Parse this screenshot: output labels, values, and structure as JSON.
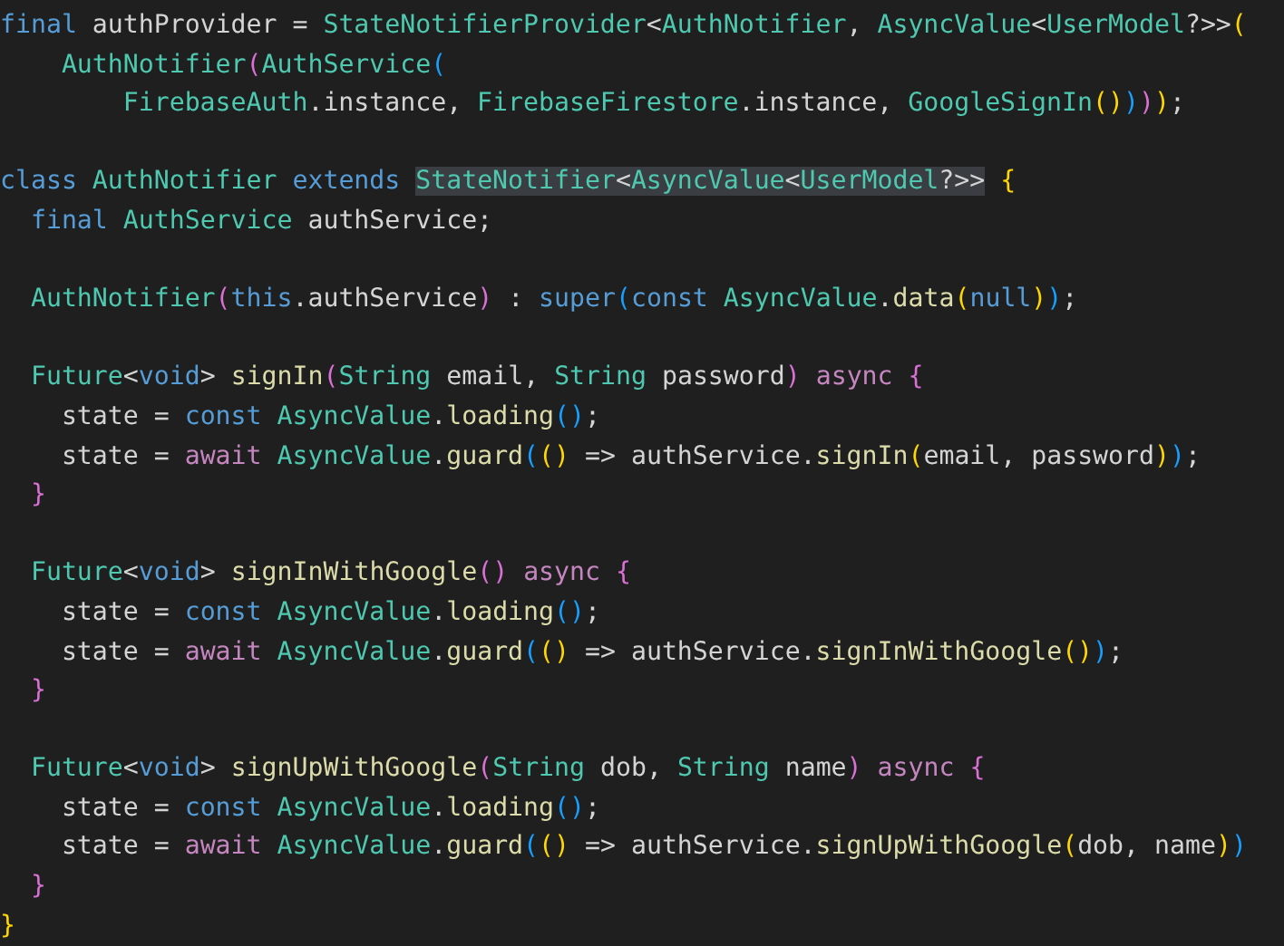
{
  "editor": {
    "lines": [
      {
        "kind": "code",
        "tokens": [
          {
            "t": "final",
            "kind": "keyword"
          },
          {
            "t": " authProvider = ",
            "kind": "plain"
          },
          {
            "t": "StateNotifierProvider",
            "kind": "type"
          },
          {
            "t": "<",
            "kind": "plain"
          },
          {
            "t": "AuthNotifier",
            "kind": "type"
          },
          {
            "t": ", ",
            "kind": "plain"
          },
          {
            "t": "AsyncValue",
            "kind": "type"
          },
          {
            "t": "<",
            "kind": "plain"
          },
          {
            "t": "UserModel",
            "kind": "type"
          },
          {
            "t": "?>>",
            "kind": "plain"
          },
          {
            "t": "(",
            "kind": "bracket1"
          }
        ]
      },
      {
        "kind": "code",
        "tokens": [
          {
            "t": "    AuthNotifier",
            "kind": "type"
          },
          {
            "t": "(",
            "kind": "bracket2"
          },
          {
            "t": "AuthService",
            "kind": "type"
          },
          {
            "t": "(",
            "kind": "bracket3"
          }
        ]
      },
      {
        "kind": "code",
        "tokens": [
          {
            "t": "        FirebaseAuth",
            "kind": "type"
          },
          {
            "t": ".instance, ",
            "kind": "plain"
          },
          {
            "t": "FirebaseFirestore",
            "kind": "type"
          },
          {
            "t": ".instance, ",
            "kind": "plain"
          },
          {
            "t": "GoogleSignIn",
            "kind": "type"
          },
          {
            "t": "()",
            "kind": "bracket1"
          },
          {
            "t": ")",
            "kind": "bracket3"
          },
          {
            "t": ")",
            "kind": "bracket2"
          },
          {
            "t": ")",
            "kind": "bracket1"
          },
          {
            "t": ";",
            "kind": "plain"
          }
        ]
      },
      {
        "kind": "blank"
      },
      {
        "kind": "code",
        "tokens": [
          {
            "t": "class",
            "kind": "keyword"
          },
          {
            "t": " AuthNotifier ",
            "kind": "type"
          },
          {
            "t": "extends ",
            "kind": "keyword"
          },
          {
            "t": "StateNotifier",
            "kind": "type",
            "highlighted": true
          },
          {
            "t": "<",
            "kind": "plain",
            "highlighted": true
          },
          {
            "t": "AsyncValue",
            "kind": "type",
            "highlighted": true
          },
          {
            "t": "<",
            "kind": "plain",
            "highlighted": true
          },
          {
            "t": "UserModel",
            "kind": "type",
            "highlighted": true
          },
          {
            "t": "?>>",
            "kind": "plain",
            "highlighted": true
          },
          {
            "t": " {",
            "kind": "bracket1"
          }
        ]
      },
      {
        "kind": "code",
        "tokens": [
          {
            "t": "  final",
            "kind": "keyword"
          },
          {
            "t": " AuthService",
            "kind": "type"
          },
          {
            "t": " authService;",
            "kind": "plain"
          }
        ]
      },
      {
        "kind": "blank"
      },
      {
        "kind": "code",
        "tokens": [
          {
            "t": "  AuthNotifier",
            "kind": "type"
          },
          {
            "t": "(",
            "kind": "bracket2"
          },
          {
            "t": "this",
            "kind": "keyword"
          },
          {
            "t": ".authService",
            "kind": "plain"
          },
          {
            "t": ")",
            "kind": "bracket2"
          },
          {
            "t": " : ",
            "kind": "plain"
          },
          {
            "t": "super",
            "kind": "keyword"
          },
          {
            "t": "(",
            "kind": "bracket3"
          },
          {
            "t": "const",
            "kind": "keyword"
          },
          {
            "t": " AsyncValue",
            "kind": "type"
          },
          {
            "t": ".",
            "kind": "plain"
          },
          {
            "t": "data",
            "kind": "function"
          },
          {
            "t": "(",
            "kind": "bracket1"
          },
          {
            "t": "null",
            "kind": "keyword"
          },
          {
            "t": ")",
            "kind": "bracket1"
          },
          {
            "t": ")",
            "kind": "bracket3"
          },
          {
            "t": ";",
            "kind": "plain"
          }
        ]
      },
      {
        "kind": "blank"
      },
      {
        "kind": "code",
        "tokens": [
          {
            "t": "  Future",
            "kind": "type"
          },
          {
            "t": "<",
            "kind": "plain"
          },
          {
            "t": "void",
            "kind": "keyword"
          },
          {
            "t": "> ",
            "kind": "plain"
          },
          {
            "t": "signIn",
            "kind": "function"
          },
          {
            "t": "(",
            "kind": "bracket2"
          },
          {
            "t": "String",
            "kind": "type"
          },
          {
            "t": " email, ",
            "kind": "plain"
          },
          {
            "t": "String",
            "kind": "type"
          },
          {
            "t": " password",
            "kind": "plain"
          },
          {
            "t": ")",
            "kind": "bracket2"
          },
          {
            "t": " async",
            "kind": "control"
          },
          {
            "t": " {",
            "kind": "bracket2"
          }
        ]
      },
      {
        "kind": "code",
        "tokens": [
          {
            "t": "    state = ",
            "kind": "plain"
          },
          {
            "t": "const",
            "kind": "keyword"
          },
          {
            "t": " AsyncValue",
            "kind": "type"
          },
          {
            "t": ".",
            "kind": "plain"
          },
          {
            "t": "loading",
            "kind": "function"
          },
          {
            "t": "()",
            "kind": "bracket3"
          },
          {
            "t": ";",
            "kind": "plain"
          }
        ]
      },
      {
        "kind": "code",
        "tokens": [
          {
            "t": "    state = ",
            "kind": "plain"
          },
          {
            "t": "await",
            "kind": "control"
          },
          {
            "t": " AsyncValue",
            "kind": "type"
          },
          {
            "t": ".",
            "kind": "plain"
          },
          {
            "t": "guard",
            "kind": "function"
          },
          {
            "t": "(",
            "kind": "bracket3"
          },
          {
            "t": "()",
            "kind": "bracket1"
          },
          {
            "t": " => authService.",
            "kind": "plain"
          },
          {
            "t": "signIn",
            "kind": "function"
          },
          {
            "t": "(",
            "kind": "bracket1"
          },
          {
            "t": "email, password",
            "kind": "plain"
          },
          {
            "t": ")",
            "kind": "bracket1"
          },
          {
            "t": ")",
            "kind": "bracket3"
          },
          {
            "t": ";",
            "kind": "plain"
          }
        ]
      },
      {
        "kind": "code",
        "tokens": [
          {
            "t": "  }",
            "kind": "bracket2"
          }
        ]
      },
      {
        "kind": "blank"
      },
      {
        "kind": "code",
        "tokens": [
          {
            "t": "  Future",
            "kind": "type"
          },
          {
            "t": "<",
            "kind": "plain"
          },
          {
            "t": "void",
            "kind": "keyword"
          },
          {
            "t": "> ",
            "kind": "plain"
          },
          {
            "t": "signInWithGoogle",
            "kind": "function"
          },
          {
            "t": "()",
            "kind": "bracket2"
          },
          {
            "t": " async",
            "kind": "control"
          },
          {
            "t": " {",
            "kind": "bracket2"
          }
        ]
      },
      {
        "kind": "code",
        "tokens": [
          {
            "t": "    state = ",
            "kind": "plain"
          },
          {
            "t": "const",
            "kind": "keyword"
          },
          {
            "t": " AsyncValue",
            "kind": "type"
          },
          {
            "t": ".",
            "kind": "plain"
          },
          {
            "t": "loading",
            "kind": "function"
          },
          {
            "t": "()",
            "kind": "bracket3"
          },
          {
            "t": ";",
            "kind": "plain"
          }
        ]
      },
      {
        "kind": "code",
        "tokens": [
          {
            "t": "    state = ",
            "kind": "plain"
          },
          {
            "t": "await",
            "kind": "control"
          },
          {
            "t": " AsyncValue",
            "kind": "type"
          },
          {
            "t": ".",
            "kind": "plain"
          },
          {
            "t": "guard",
            "kind": "function"
          },
          {
            "t": "(",
            "kind": "bracket3"
          },
          {
            "t": "()",
            "kind": "bracket1"
          },
          {
            "t": " => authService.",
            "kind": "plain"
          },
          {
            "t": "signInWithGoogle",
            "kind": "function"
          },
          {
            "t": "()",
            "kind": "bracket1"
          },
          {
            "t": ")",
            "kind": "bracket3"
          },
          {
            "t": ";",
            "kind": "plain"
          }
        ]
      },
      {
        "kind": "code",
        "tokens": [
          {
            "t": "  }",
            "kind": "bracket2"
          }
        ]
      },
      {
        "kind": "blank"
      },
      {
        "kind": "code",
        "tokens": [
          {
            "t": "  Future",
            "kind": "type"
          },
          {
            "t": "<",
            "kind": "plain"
          },
          {
            "t": "void",
            "kind": "keyword"
          },
          {
            "t": "> ",
            "kind": "plain"
          },
          {
            "t": "signUpWithGoogle",
            "kind": "function"
          },
          {
            "t": "(",
            "kind": "bracket2"
          },
          {
            "t": "String",
            "kind": "type"
          },
          {
            "t": " dob, ",
            "kind": "plain"
          },
          {
            "t": "String",
            "kind": "type"
          },
          {
            "t": " name",
            "kind": "plain"
          },
          {
            "t": ")",
            "kind": "bracket2"
          },
          {
            "t": " async",
            "kind": "control"
          },
          {
            "t": " {",
            "kind": "bracket2"
          }
        ]
      },
      {
        "kind": "code",
        "tokens": [
          {
            "t": "    state = ",
            "kind": "plain"
          },
          {
            "t": "const",
            "kind": "keyword"
          },
          {
            "t": " AsyncValue",
            "kind": "type"
          },
          {
            "t": ".",
            "kind": "plain"
          },
          {
            "t": "loading",
            "kind": "function"
          },
          {
            "t": "()",
            "kind": "bracket3"
          },
          {
            "t": ";",
            "kind": "plain"
          }
        ]
      },
      {
        "kind": "code",
        "tokens": [
          {
            "t": "    state = ",
            "kind": "plain"
          },
          {
            "t": "await",
            "kind": "control"
          },
          {
            "t": " AsyncValue",
            "kind": "type"
          },
          {
            "t": ".",
            "kind": "plain"
          },
          {
            "t": "guard",
            "kind": "function"
          },
          {
            "t": "(",
            "kind": "bracket3"
          },
          {
            "t": "()",
            "kind": "bracket1"
          },
          {
            "t": " => authService.",
            "kind": "plain"
          },
          {
            "t": "signUpWithGoogle",
            "kind": "function"
          },
          {
            "t": "(",
            "kind": "bracket1"
          },
          {
            "t": "dob, name",
            "kind": "plain"
          },
          {
            "t": ")",
            "kind": "bracket1"
          },
          {
            "t": ")",
            "kind": "bracket3"
          }
        ]
      },
      {
        "kind": "code",
        "tokens": [
          {
            "t": "  }",
            "kind": "bracket2"
          }
        ]
      },
      {
        "kind": "code",
        "tokens": [
          {
            "t": "}",
            "kind": "bracket1"
          }
        ]
      }
    ]
  }
}
